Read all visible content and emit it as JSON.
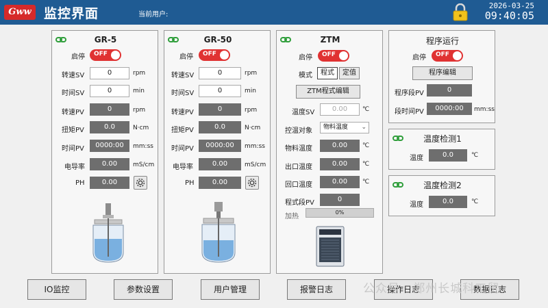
{
  "header": {
    "logo_text": "Gww",
    "title": "监控界面",
    "user_label": "当前用户:",
    "date": "2026-03-25",
    "time": "09:40:05"
  },
  "gr5": {
    "title": "GR-5",
    "start_stop_label": "启停",
    "toggle_state": "OFF",
    "speed_sv_label": "转速SV",
    "speed_sv_value": "0",
    "speed_sv_unit": "rpm",
    "time_sv_label": "时间SV",
    "time_sv_value": "0",
    "time_sv_unit": "min",
    "speed_pv_label": "转速PV",
    "speed_pv_value": "0",
    "speed_pv_unit": "rpm",
    "torque_pv_label": "扭矩PV",
    "torque_pv_value": "0.0",
    "torque_pv_unit": "N·cm",
    "time_pv_label": "时间PV",
    "time_pv_value": "0000:00",
    "time_pv_unit": "mm:ss",
    "conductivity_label": "电导率",
    "conductivity_value": "0.00",
    "conductivity_unit": "mS/cm",
    "ph_label": "PH",
    "ph_value": "0.00"
  },
  "gr50": {
    "title": "GR-50",
    "start_stop_label": "启停",
    "toggle_state": "OFF",
    "speed_sv_label": "转速SV",
    "speed_sv_value": "0",
    "speed_sv_unit": "rpm",
    "time_sv_label": "时间SV",
    "time_sv_value": "0",
    "time_sv_unit": "min",
    "speed_pv_label": "转速PV",
    "speed_pv_value": "0",
    "speed_pv_unit": "rpm",
    "torque_pv_label": "扭矩PV",
    "torque_pv_value": "0.0",
    "torque_pv_unit": "N·cm",
    "time_pv_label": "时间PV",
    "time_pv_value": "0000:00",
    "time_pv_unit": "mm:ss",
    "conductivity_label": "电导率",
    "conductivity_value": "0.00",
    "conductivity_unit": "mS/cm",
    "ph_label": "PH",
    "ph_value": "0.00"
  },
  "ztm": {
    "title": "ZTM",
    "start_stop_label": "启停",
    "toggle_state": "OFF",
    "mode_label": "模式",
    "mode_program": "程式",
    "mode_fixed": "定值",
    "program_edit_button": "ZTM程式编辑",
    "temp_sv_label": "温度SV",
    "temp_sv_value": "0.00",
    "temp_sv_unit": "℃",
    "control_target_label": "控温对象",
    "control_target_value": "物料温度",
    "material_temp_label": "物料温度",
    "material_temp_value": "0.00",
    "material_temp_unit": "℃",
    "outlet_temp_label": "出口温度",
    "outlet_temp_value": "0.00",
    "outlet_temp_unit": "℃",
    "return_temp_label": "回口温度",
    "return_temp_value": "0.00",
    "return_temp_unit": "℃",
    "program_pv_label": "程式段PV",
    "program_pv_value": "0",
    "heating_label": "加热",
    "heating_percent": 0,
    "heating_text": "0%"
  },
  "program_run": {
    "title": "程序运行",
    "start_stop_label": "启停",
    "toggle_state": "OFF",
    "edit_button": "程序编辑",
    "segment_pv_label": "程序段PV",
    "segment_pv_value": "0",
    "segment_time_pv_label": "段时间PV",
    "segment_time_pv_value": "0000:00",
    "segment_time_pv_unit": "mm:ss"
  },
  "temp_detect_1": {
    "title": "温度检测1",
    "temp_label": "温度",
    "temp_value": "0.0",
    "temp_unit": "℃"
  },
  "temp_detect_2": {
    "title": "温度检测2",
    "temp_label": "温度",
    "temp_value": "0.0",
    "temp_unit": "℃"
  },
  "bottom_nav": {
    "io_monitor": "IO监控",
    "param_settings": "参数设置",
    "user_management": "用户管理",
    "alarm_log": "报警日志",
    "operation_log": "操作日志",
    "data_log": "数据日志"
  },
  "watermark": "公众号 · 郑州长城科工贸",
  "colors": {
    "header_bg": "#1f5b93",
    "toggle_off": "#e03232",
    "pv_bg": "#6e6e6e",
    "link_green": "#2e9e3a",
    "logo_red": "#d62a2a"
  }
}
